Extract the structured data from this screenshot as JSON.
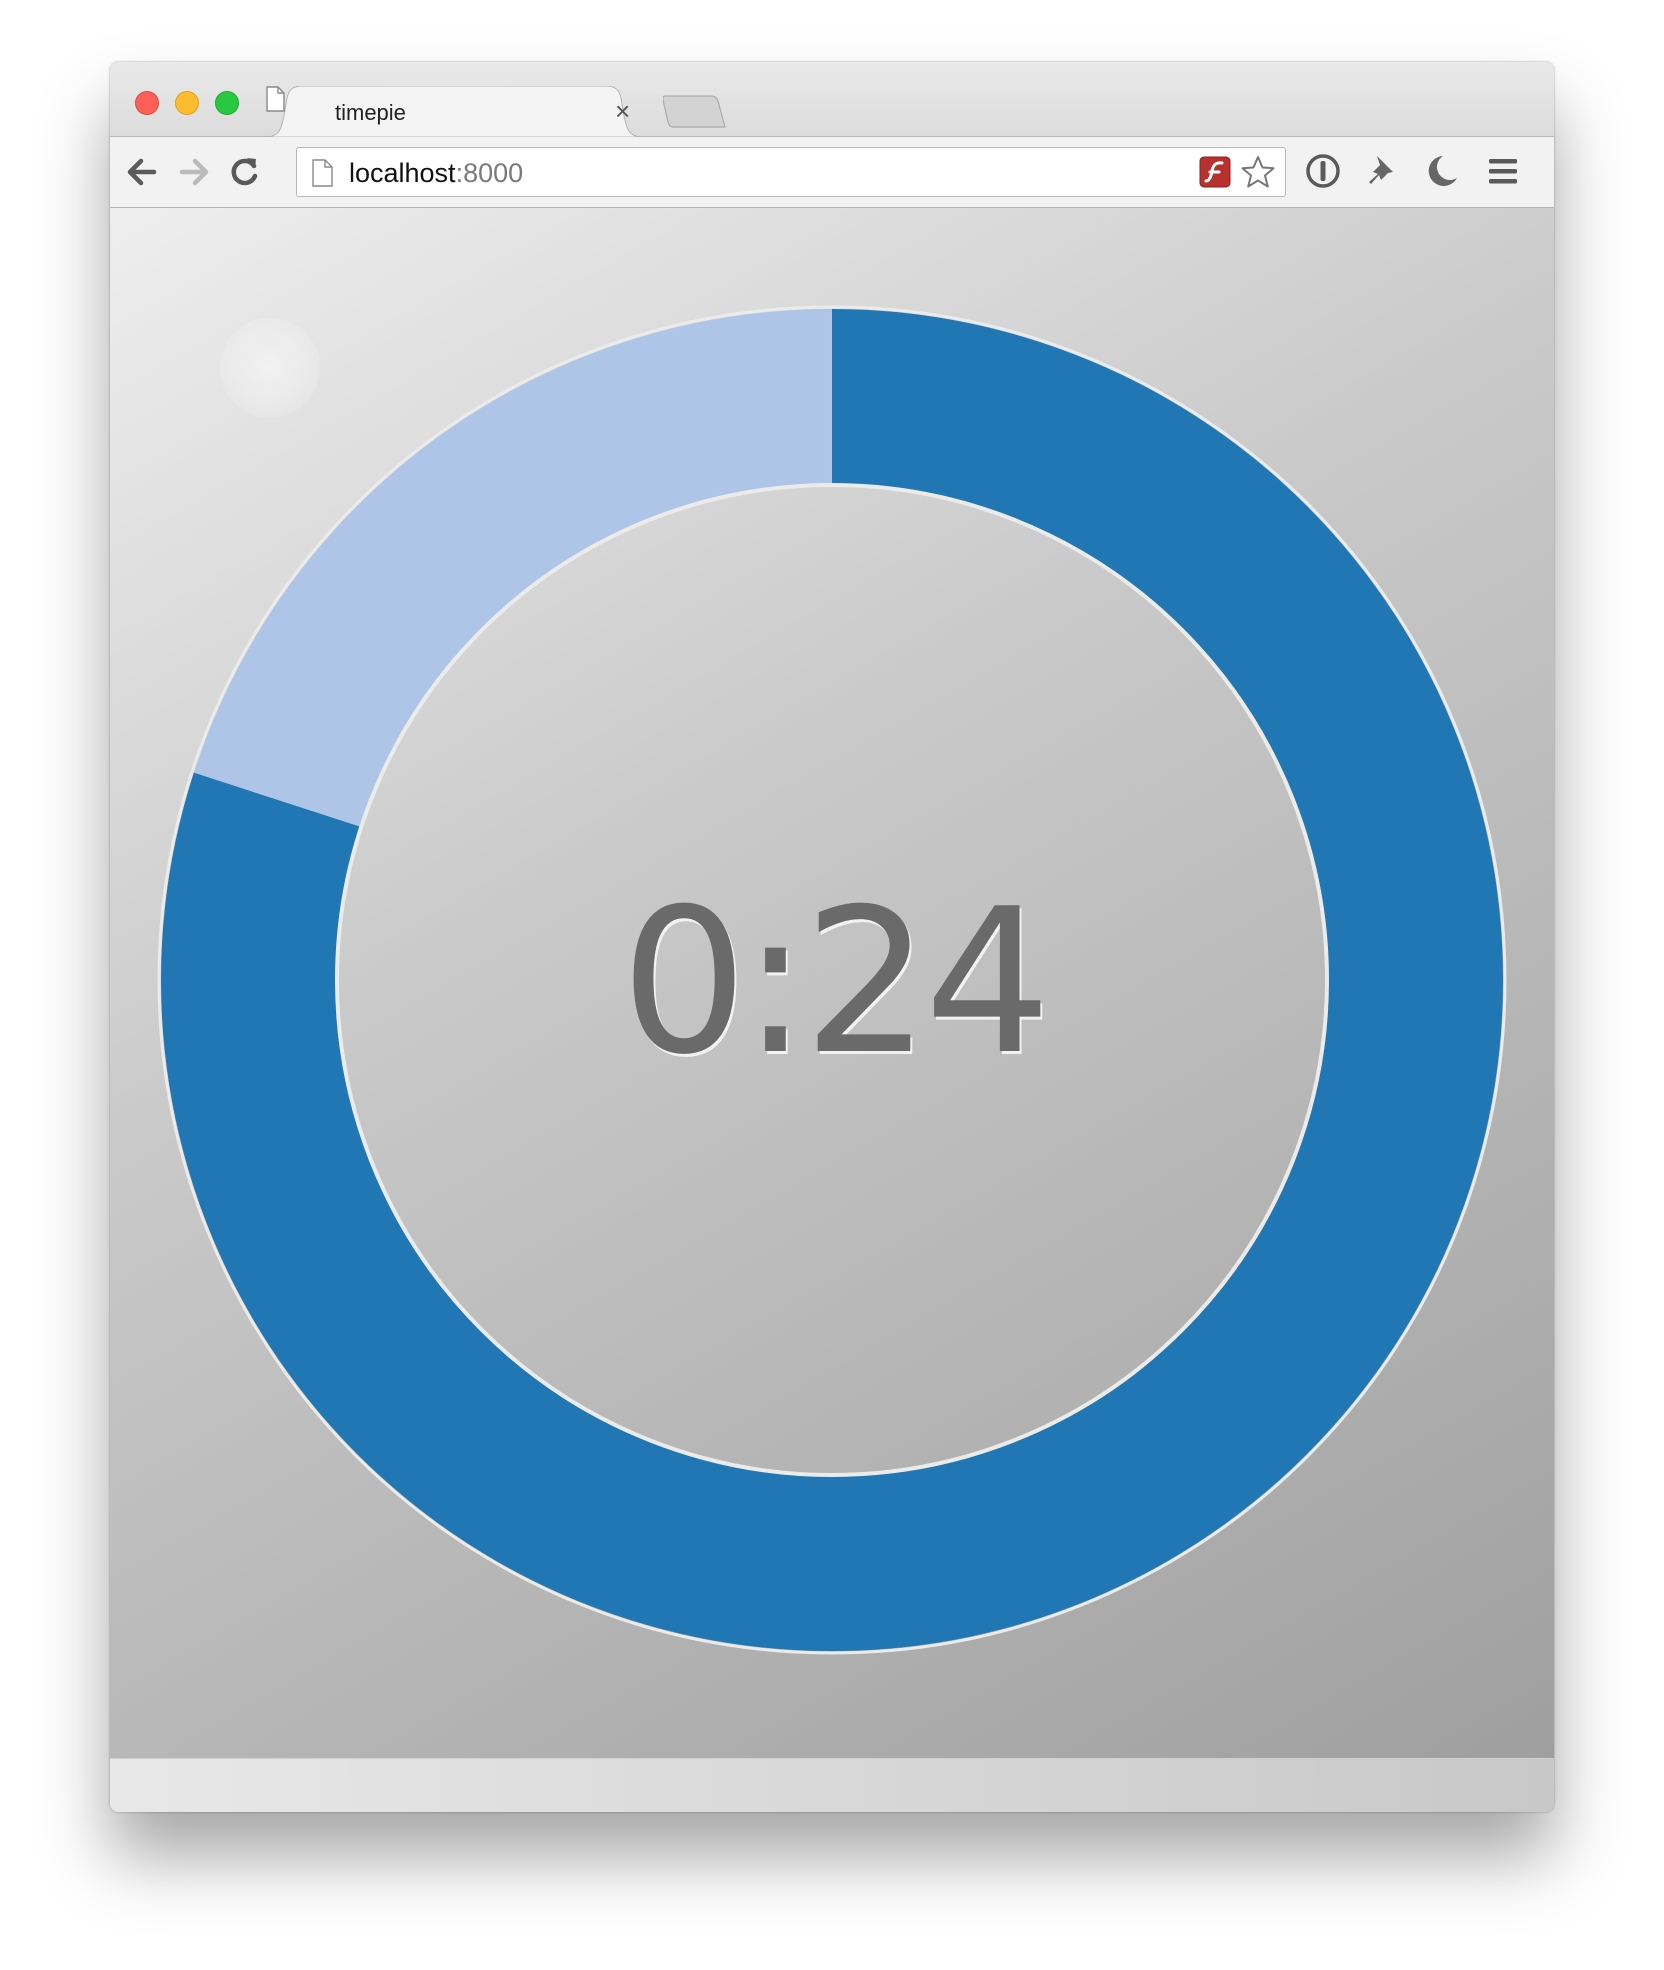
{
  "browser": {
    "tab_title": "timepie",
    "tab_close_glyph": "×",
    "url_host": "localhost",
    "url_port": ":8000",
    "icons": [
      "back-arrow-icon",
      "forward-arrow-icon",
      "reload-icon",
      "page-icon",
      "flash-icon",
      "bookmark-star-icon",
      "password-manager-icon",
      "pin-icon",
      "moon-icon",
      "menu-icon"
    ]
  },
  "timer": {
    "display": "0:24",
    "remaining_fraction": 0.8,
    "colors": {
      "remaining": "#2077b4",
      "elapsed": "#aec5e8",
      "stroke": "#ebebeb"
    }
  }
}
